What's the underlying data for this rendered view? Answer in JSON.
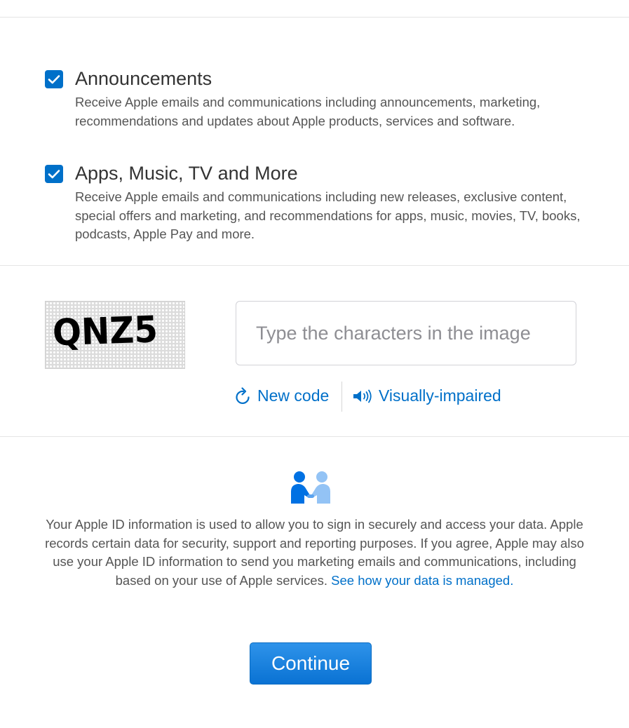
{
  "preferences": [
    {
      "title": "Announcements",
      "description": "Receive Apple emails and communications including announcements, marketing, recommendations and updates about Apple products, services and software.",
      "checked": true
    },
    {
      "title": "Apps, Music, TV and More",
      "description": "Receive Apple emails and communications including new releases, exclusive content, special offers and marketing, and recommendations for apps, music, movies, TV, books, podcasts, Apple Pay and more.",
      "checked": true
    }
  ],
  "captcha": {
    "code": "QNZ5",
    "input_placeholder": "Type the characters in the image",
    "input_value": "",
    "new_code_label": "New code",
    "visually_impaired_label": "Visually-impaired",
    "icons": {
      "refresh": "refresh-icon",
      "speaker": "speaker-icon"
    }
  },
  "privacy": {
    "icon": "handshake-people-icon",
    "text": "Your Apple ID information is used to allow you to sign in securely and access your data. Apple records certain data for security, support and reporting purposes. If you agree, Apple may also use your Apple ID information to send you marketing emails and communications, including based on your use of Apple services.",
    "link_text": "See how your data is managed."
  },
  "continue_label": "Continue",
  "colors": {
    "accent": "#0070c9",
    "text": "#333333",
    "muted": "#555555",
    "divider": "#e5e5e5"
  }
}
